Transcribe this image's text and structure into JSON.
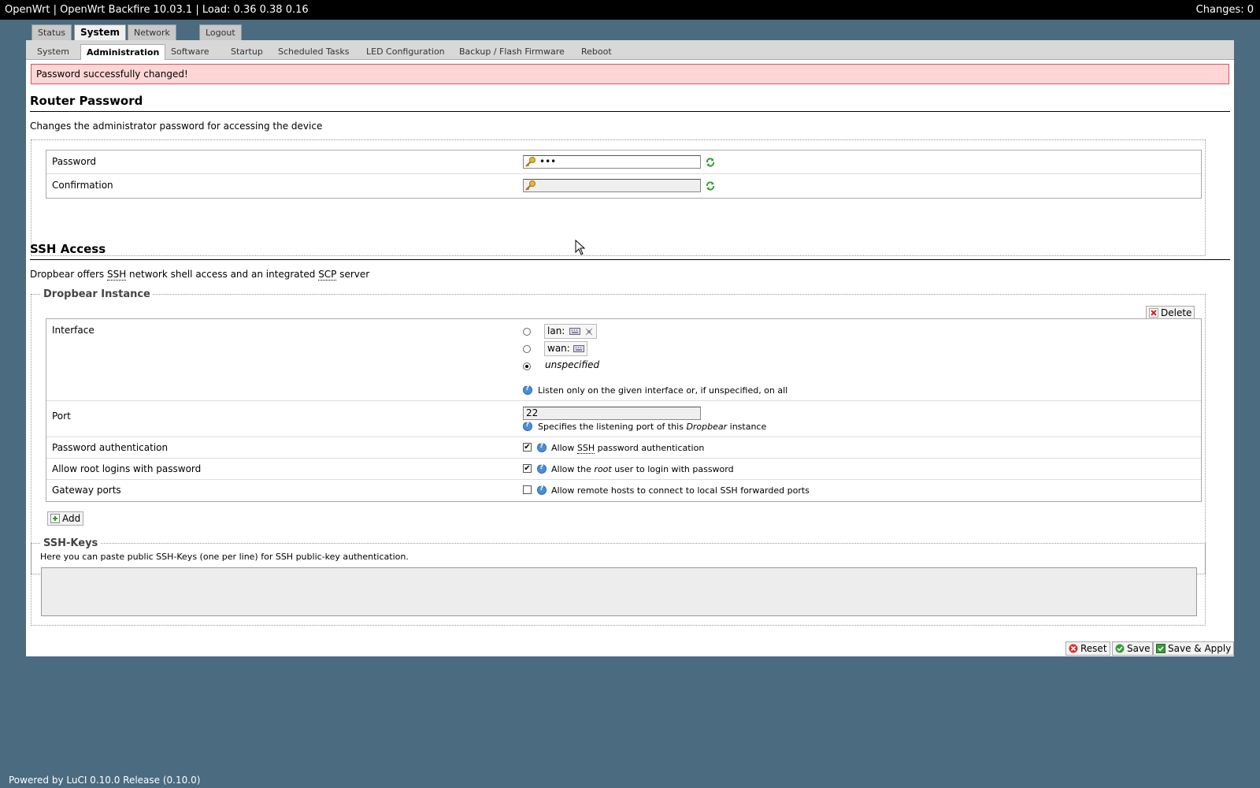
{
  "topbar": {
    "title": "OpenWrt | OpenWrt Backfire 10.03.1 | Load: 0.36 0.38 0.16",
    "changes": "Changes: 0"
  },
  "main_tabs": [
    "Status",
    "System",
    "Network",
    "Logout"
  ],
  "sub_tabs": [
    "System",
    "Administration",
    "Software",
    "Startup",
    "Scheduled Tasks",
    "LED Configuration",
    "Backup / Flash Firmware",
    "Reboot"
  ],
  "alert": "Password successfully changed!",
  "router_password": {
    "title": "Router Password",
    "description": "Changes the administrator password for accessing the device",
    "password_label": "Password",
    "password_value": "•••",
    "confirmation_label": "Confirmation",
    "confirmation_value": ""
  },
  "ssh": {
    "title": "SSH Access",
    "desc_1": "Dropbear offers ",
    "desc_ssh": "SSH",
    "desc_2": " network shell access and an integrated ",
    "desc_scp": "SCP",
    "desc_3": " server",
    "instance_legend": "Dropbear Instance",
    "delete_label": "Delete",
    "interface_label": "Interface",
    "interface_options": [
      "lan:",
      "wan:",
      "unspecified"
    ],
    "interface_selected": "unspecified",
    "interface_help": "Listen only on the given interface or, if unspecified, on all",
    "port_label": "Port",
    "port_value": "22",
    "port_help_1": "Specifies the listening port of this ",
    "port_help_em": "Dropbear",
    "port_help_2": " instance",
    "pw_auth_label": "Password authentication",
    "pw_auth_checked": true,
    "pw_auth_help_1": "Allow ",
    "pw_auth_help_abbr": "SSH",
    "pw_auth_help_2": " password authentication",
    "root_login_label": "Allow root logins with password",
    "root_login_checked": true,
    "root_login_help_1": "Allow the ",
    "root_login_help_em": "root",
    "root_login_help_2": " user to login with password",
    "gateway_label": "Gateway ports",
    "gateway_checked": false,
    "gateway_help": "Allow remote hosts to connect to local SSH forwarded ports",
    "add_label": "Add"
  },
  "ssh_keys": {
    "legend": "SSH-Keys",
    "description": "Here you can paste public SSH-Keys (one per line) for SSH public-key authentication.",
    "value": ""
  },
  "actions": {
    "reset": "Reset",
    "save": "Save",
    "save_apply": "Save & Apply"
  },
  "footer": "Powered by LuCI 0.10.0 Release (0.10.0)",
  "colors": {
    "background": "#4a6b80",
    "alert_bg": "#ffd6d6",
    "alert_border": "#e05050"
  }
}
